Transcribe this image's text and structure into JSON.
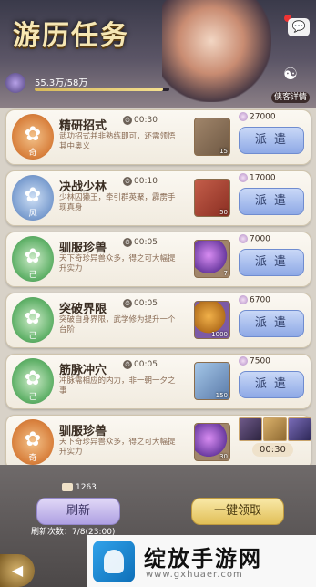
{
  "header": {
    "title": "游历任务",
    "progress_text": "55.3万/58万",
    "progress_fraction": 0.953,
    "chat_icon": "💬",
    "hero_detail_label": "侠客详情"
  },
  "tasks": [
    {
      "name": "精研招式",
      "timer": "00:30",
      "desc": "武功招式并非熟练即可，还需领悟其中奥义",
      "emblem_color": "orange",
      "emblem_sub": "奇",
      "reward_type": "book",
      "reward_count": "15",
      "silver": "27000",
      "action": "派 遣"
    },
    {
      "name": "决战少林",
      "timer": "00:10",
      "desc": "少林囚獭王，牵引群英聚，霹雳手现真身",
      "emblem_color": "blue",
      "emblem_sub": "风",
      "reward_type": "scroll",
      "reward_count": "50",
      "silver": "17000",
      "action": "派 遣"
    },
    {
      "name": "驯服珍兽",
      "timer": "00:05",
      "desc": "天下奇珍异兽众多，得之可大幅提升实力",
      "emblem_color": "green",
      "emblem_sub": "己",
      "reward_type": "orb",
      "reward_count": "7",
      "silver": "7000",
      "action": "派 遣"
    },
    {
      "name": "突破界限",
      "timer": "00:05",
      "desc": "突破自身界限，武学修为提升一个台阶",
      "emblem_color": "green",
      "emblem_sub": "己",
      "reward_type": "gold",
      "reward_count": "1000",
      "silver": "6700",
      "action": "派 遣"
    },
    {
      "name": "筋脉冲穴",
      "timer": "00:05",
      "desc": "冲脉需相应的内力，非一朝一夕之事",
      "emblem_color": "green",
      "emblem_sub": "己",
      "reward_type": "map",
      "reward_count": "150",
      "silver": "7500",
      "action": "派 遣"
    },
    {
      "name": "驯服珍兽",
      "timer": "",
      "desc": "天下奇珍异兽众多，得之可大幅提升实力",
      "emblem_color": "orange",
      "emblem_sub": "奇",
      "reward_type": "orb",
      "reward_count": "30",
      "countdown": "00:30",
      "in_progress": true
    }
  ],
  "footer": {
    "ticket_count": "1263",
    "refresh_label": "刷新",
    "refresh_count": "刷新次数：7/8(23:00)",
    "claim_all_label": "一键领取"
  },
  "watermark": {
    "text": "绽放手游网",
    "url": "www.gxhuaer.com"
  }
}
